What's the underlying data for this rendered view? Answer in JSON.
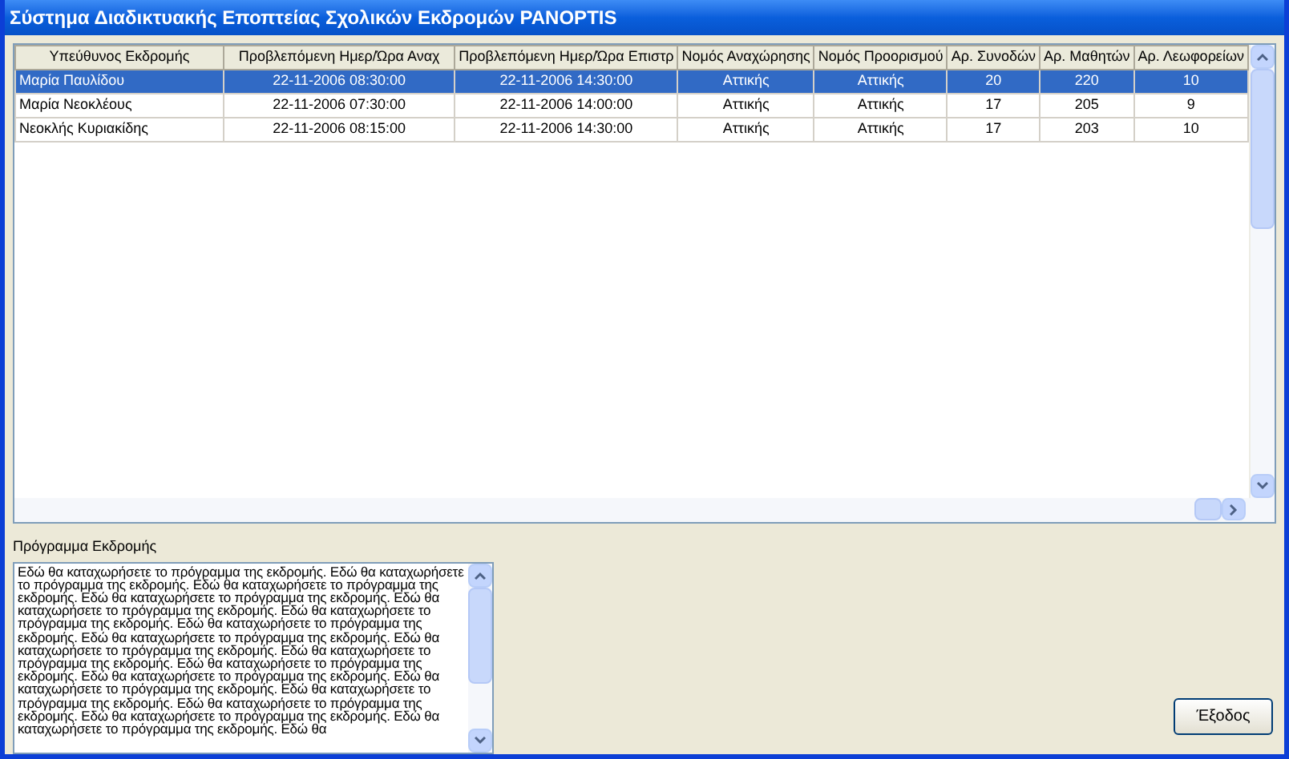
{
  "window": {
    "title": "Σύστημα Διαδικτυακής Εποπτείας Σχολικών Εκδρομών PANOPTIS"
  },
  "table": {
    "columns": [
      "Υπεύθυνος Εκδρομής",
      "Προβλεπόμενη Ημερ/Ώρα Αναχ",
      "Προβλεπόμενη Ημερ/Ώρα Επιστρ",
      "Νομός Αναχώρησης",
      "Νομός Προορισμού",
      "Αρ. Συνοδών",
      "Αρ. Μαθητών",
      "Αρ. Λεωφορείων"
    ],
    "rows": [
      {
        "selected": true,
        "cells": [
          "Μαρία Παυλίδου",
          "22-11-2006 08:30:00",
          "22-11-2006 14:30:00",
          "Αττικής",
          "Αττικής",
          "20",
          "220",
          "10"
        ]
      },
      {
        "selected": false,
        "cells": [
          "Μαρία Νεοκλέους",
          "22-11-2006 07:30:00",
          "22-11-2006 14:00:00",
          "Αττικής",
          "Αττικής",
          "17",
          "205",
          "9"
        ]
      },
      {
        "selected": false,
        "cells": [
          "Νεοκλής Κυριακίδης",
          "22-11-2006 08:15:00",
          "22-11-2006 14:30:00",
          "Αττικής",
          "Αττικής",
          "17",
          "203",
          "10"
        ]
      }
    ]
  },
  "program": {
    "label": "Πρόγραμμα Εκδρομής",
    "value": "Εδώ θα καταχωρήσετε το πρόγραμμα της εκδρομής. Εδώ θα καταχωρήσετε το πρόγραμμα της εκδρομής. Εδώ θα καταχωρήσετε το πρόγραμμα της εκδρομής. Εδώ θα καταχωρήσετε το πρόγραμμα της εκδρομής. Εδώ θα καταχωρήσετε το πρόγραμμα της εκδρομής. Εδώ θα καταχωρήσετε το πρόγραμμα της εκδρομής. Εδώ θα καταχωρήσετε το πρόγραμμα της εκδρομής. Εδώ θα καταχωρήσετε το πρόγραμμα της εκδρομής. Εδώ θα καταχωρήσετε το πρόγραμμα της εκδρομής. Εδώ θα καταχωρήσετε το πρόγραμμα της εκδρομής. Εδώ θα καταχωρήσετε το πρόγραμμα της εκδρομής. Εδώ θα καταχωρήσετε το πρόγραμμα της εκδρομής. Εδώ θα καταχωρήσετε το πρόγραμμα της εκδρομής. Εδώ θα καταχωρήσετε το πρόγραμμα της εκδρομής. Εδώ θα καταχωρήσετε το πρόγραμμα της εκδρομής. Εδώ θα καταχωρήσετε το πρόγραμμα της εκδρομής. Εδώ θα καταχωρήσετε το πρόγραμμα της εκδρομής. Εδώ θα"
  },
  "exit_button": {
    "label": "Έξοδος"
  }
}
